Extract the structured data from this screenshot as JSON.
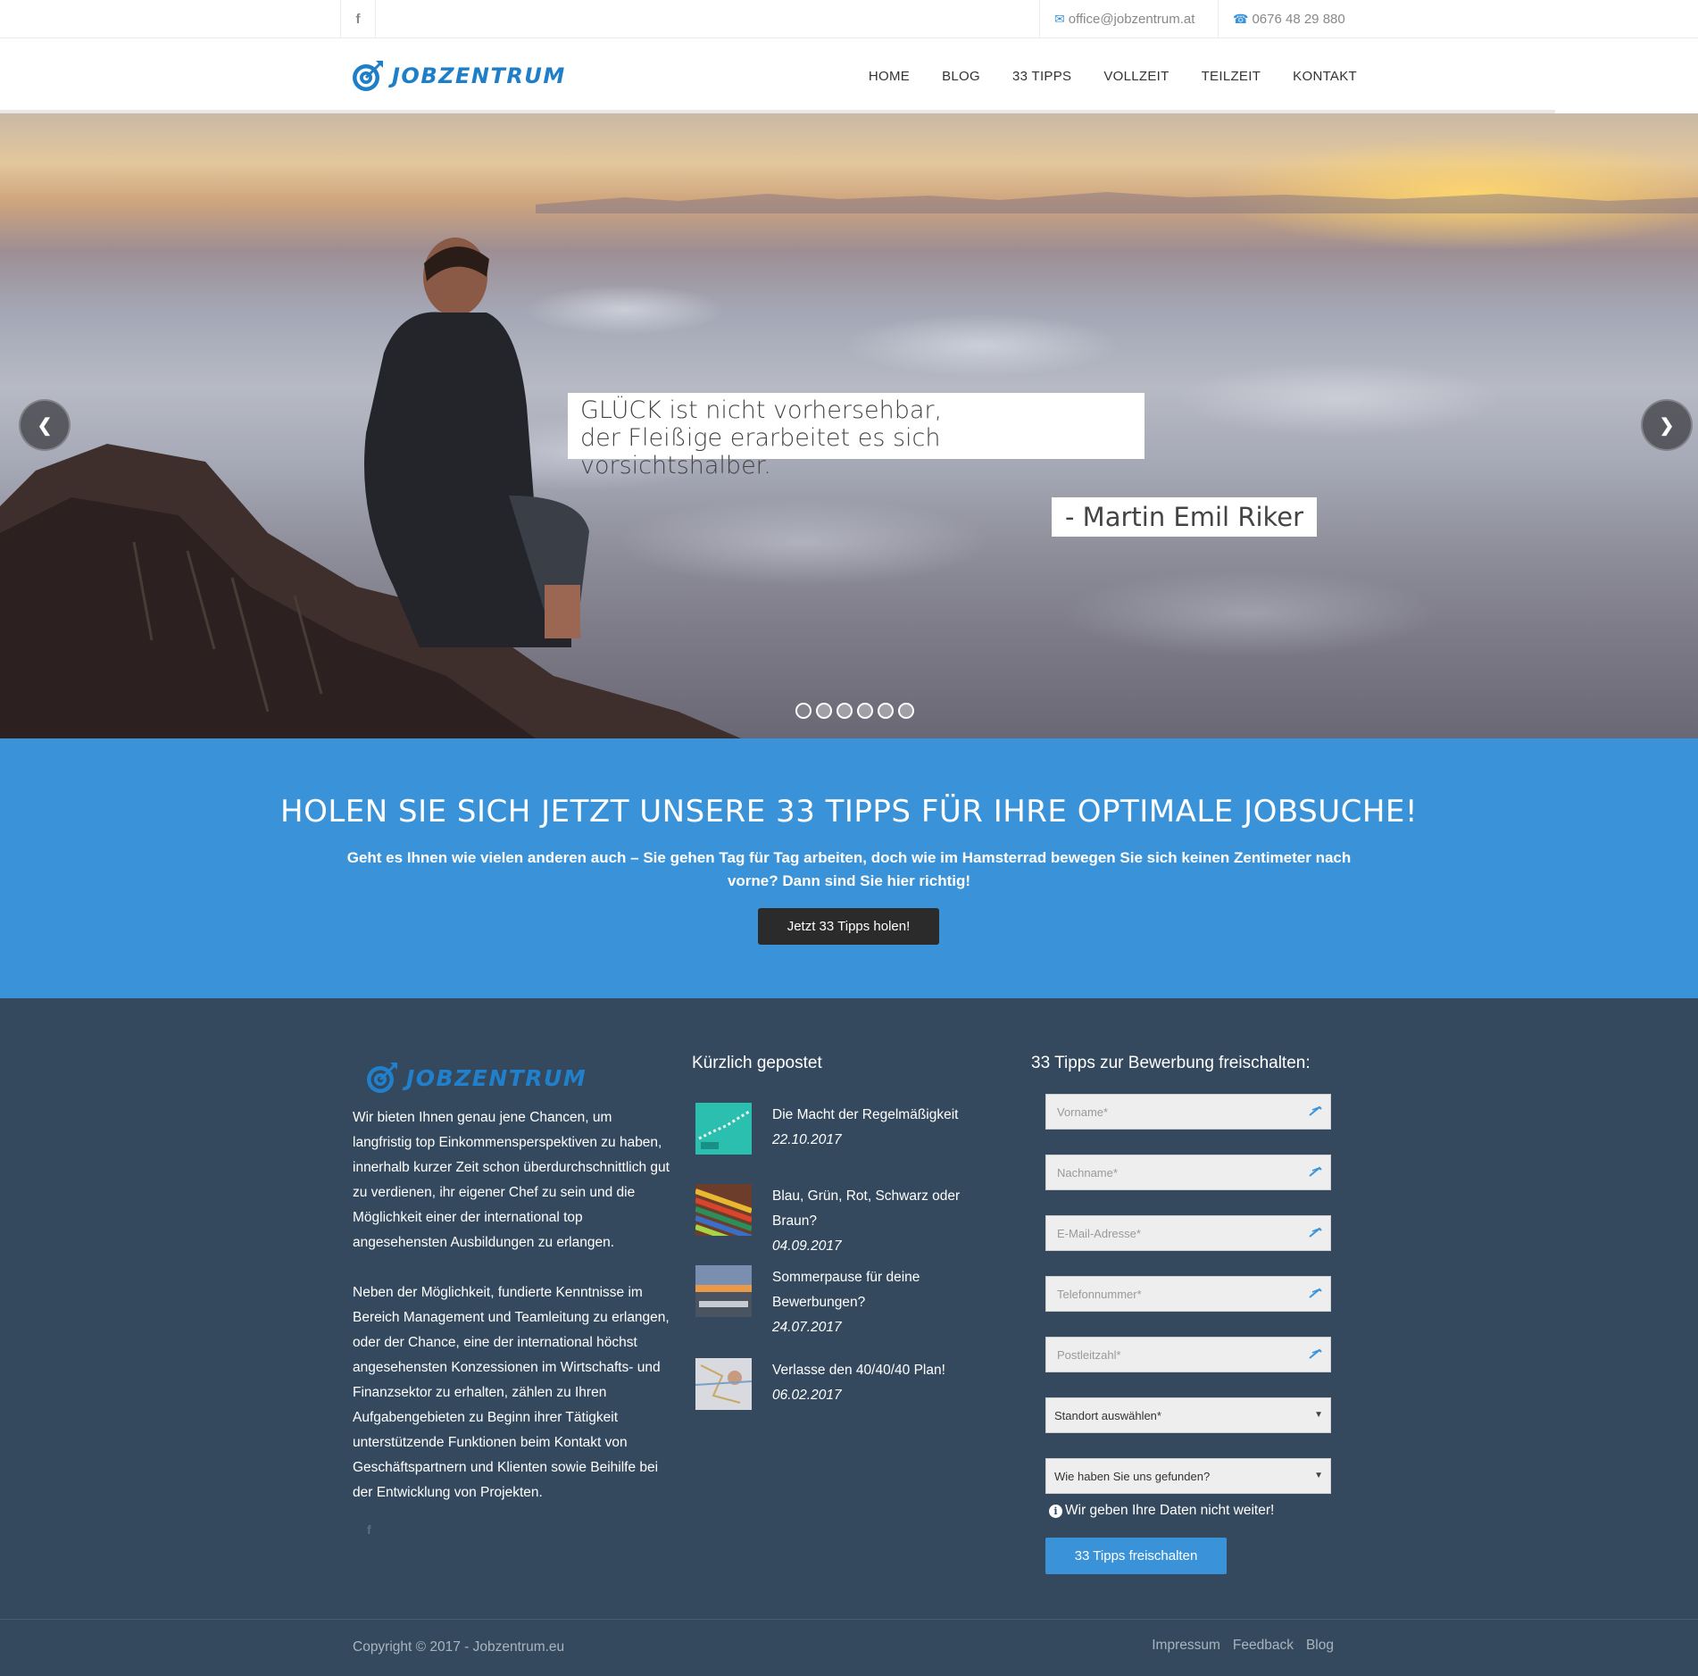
{
  "topbar": {
    "facebook_icon": "f",
    "email": "office@jobzentrum.at",
    "phone": "0676 48 29 880"
  },
  "header": {
    "logo_text": "JOBZENTRUM",
    "nav": [
      "HOME",
      "BLOG",
      "33 TIPPS",
      "VOLLZEIT",
      "TEILZEIT",
      "KONTAKT"
    ]
  },
  "hero": {
    "quote_line1": "GLÜCK ist nicht vorhersehbar,",
    "quote_line2": "der Fleißige erarbeitet es sich vorsichtshalber.",
    "author": "- Martin Emil Riker",
    "prev_arrow": "❮",
    "next_arrow": "❯",
    "slide_count": 6,
    "active_slide": 1
  },
  "cta": {
    "heading": "HOLEN SIE SICH JETZT UNSERE 33 TIPPS FÜR IHRE OPTIMALE JOBSUCHE!",
    "text": "Geht es Ihnen wie vielen anderen auch – Sie gehen Tag für Tag arbeiten, doch wie im Hamsterrad bewegen Sie sich keinen Zentimeter nach vorne? Dann sind Sie hier richtig!",
    "button": "Jetzt 33 Tipps holen!"
  },
  "footer": {
    "logo_text": "JOBZENTRUM",
    "about_p1": "Wir bieten Ihnen genau jene Chancen, um langfristig top Einkommensperspektiven zu haben, innerhalb kurzer Zeit schon überdurchschnittlich gut zu verdienen, ihr eigener Chef zu sein und die Möglichkeit einer der international top angesehensten Ausbildungen zu erlangen.",
    "about_p2": "Neben der Möglichkeit, fundierte Kenntnisse im Bereich Management und Teamleitung zu erlangen, oder der Chance, eine der international höchst angesehensten Konzessionen im Wirtschafts- und Finanzsektor zu erhalten, zählen zu Ihren Aufgabengebieten zu Beginn ihrer Tätigkeit unterstützende Funktionen beim Kontakt von Geschäftspartnern und Klienten sowie Beihilfe bei der Entwicklung von Projekten.",
    "facebook_icon": "f",
    "recent_title": "Kürzlich gepostet",
    "posts": [
      {
        "title": "Die Macht der Regelmäßigkeit",
        "date": "22.10.2017"
      },
      {
        "title": "Blau, Grün, Rot, Schwarz oder Braun?",
        "date": "04.09.2017"
      },
      {
        "title": "Sommerpause für deine Bewerbungen?",
        "date": "24.07.2017"
      },
      {
        "title": "Verlasse den 40/40/40 Plan!",
        "date": "06.02.2017"
      }
    ],
    "form_title": "33 Tipps zur Bewerbung freischalten:",
    "form": {
      "vorname": "Vorname*",
      "nachname": "Nachname*",
      "email": "E-Mail-Adresse*",
      "telefon": "Telefonnummer*",
      "plz": "Postleitzahl*",
      "standort": "Standort auswählen*",
      "gefunden": "Wie haben Sie uns gefunden?",
      "privacy": "Wir geben Ihre Daten nicht weiter!",
      "submit": "33 Tipps freischalten"
    }
  },
  "bottom": {
    "copyright": "Copyright © 2017 - Jobzentrum.eu",
    "links": [
      "Impressum",
      "Feedback",
      "Blog"
    ]
  },
  "colors": {
    "accent": "#3a93d8",
    "footer_bg": "#34495e",
    "logo": "#1e7fc8",
    "cta_button": "#2b2b2b"
  }
}
